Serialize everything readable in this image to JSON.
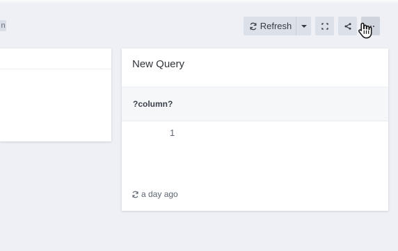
{
  "left_chip": {
    "label": "n"
  },
  "toolbar": {
    "refresh_label": "Refresh",
    "refresh_icon": "refresh-icon",
    "caret_icon": "chevron-down-icon",
    "fullscreen_icon": "fullscreen-icon",
    "share_icon": "share-icon",
    "more_icon": "more-horizontal-icon"
  },
  "widget": {
    "title": "New Query",
    "column_name": "?column?",
    "value": "1",
    "updated_icon": "refresh-icon",
    "updated_text": "a day ago"
  },
  "cursor": {
    "icon": "hand-pointer-icon"
  },
  "colors": {
    "page_background": "#eef0f5",
    "panel_background": "#ffffff",
    "button_background": "#dce0e8",
    "table_header_background": "#f6f7f9"
  }
}
